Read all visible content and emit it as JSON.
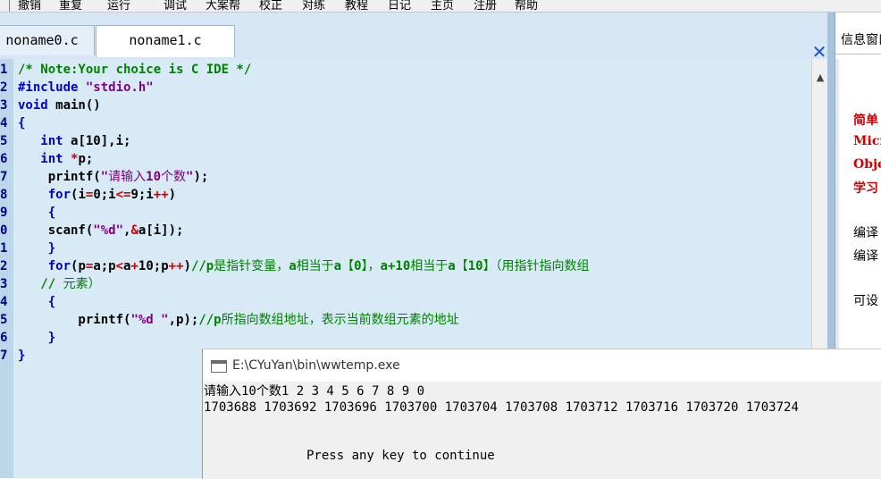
{
  "menu": [
    "撤销",
    "重复",
    "运行",
    "调试",
    "大案帮",
    "校正",
    "对练",
    "教程",
    "日记",
    "主页",
    "注册",
    "帮助"
  ],
  "tabs": [
    {
      "label": "noname0.c",
      "active": false
    },
    {
      "label": "noname1.c",
      "active": true
    }
  ],
  "editor": {
    "line_numbers": [
      "1",
      "2",
      "3",
      "4",
      "5",
      "6",
      "7",
      "8",
      "9",
      "0",
      "1",
      "2",
      "3",
      "4",
      "5",
      "6",
      "7"
    ],
    "lines": [
      [
        {
          "t": "/* Note:Your choice is C IDE */",
          "c": "cm"
        }
      ],
      [
        {
          "t": "#include ",
          "c": "kw"
        },
        {
          "t": "\"stdio.h\"",
          "c": "str"
        }
      ],
      [
        {
          "t": "void",
          "c": "kw"
        },
        {
          "t": " main()",
          "c": ""
        }
      ],
      [
        {
          "t": "{",
          "c": "kw"
        }
      ],
      [
        {
          "t": "   ",
          "c": ""
        },
        {
          "t": "int",
          "c": "kw"
        },
        {
          "t": " a[10],i;",
          "c": ""
        }
      ],
      [
        {
          "t": "   ",
          "c": ""
        },
        {
          "t": "int",
          "c": "kw"
        },
        {
          "t": " ",
          "c": ""
        },
        {
          "t": "*",
          "c": "op"
        },
        {
          "t": "p;",
          "c": ""
        }
      ],
      [
        {
          "t": "    printf(",
          "c": ""
        },
        {
          "t": "\"",
          "c": "str"
        },
        {
          "t": "请输入",
          "c": "str cn"
        },
        {
          "t": "10",
          "c": "str"
        },
        {
          "t": "个数",
          "c": "str cn"
        },
        {
          "t": "\"",
          "c": "str"
        },
        {
          "t": ");",
          "c": ""
        }
      ],
      [
        {
          "t": "    ",
          "c": ""
        },
        {
          "t": "for",
          "c": "kw"
        },
        {
          "t": "(i",
          "c": ""
        },
        {
          "t": "=",
          "c": "op"
        },
        {
          "t": "0;i",
          "c": ""
        },
        {
          "t": "<=",
          "c": "op"
        },
        {
          "t": "9;i",
          "c": ""
        },
        {
          "t": "++",
          "c": "op"
        },
        {
          "t": ")",
          "c": ""
        }
      ],
      [
        {
          "t": "    {",
          "c": "kw"
        }
      ],
      [
        {
          "t": "    scanf(",
          "c": ""
        },
        {
          "t": "\"%d\"",
          "c": "str"
        },
        {
          "t": ",",
          "c": ""
        },
        {
          "t": "&",
          "c": "op"
        },
        {
          "t": "a[i]);",
          "c": ""
        }
      ],
      [
        {
          "t": "    }",
          "c": "kw"
        }
      ],
      [
        {
          "t": "    ",
          "c": ""
        },
        {
          "t": "for",
          "c": "kw"
        },
        {
          "t": "(p",
          "c": ""
        },
        {
          "t": "=",
          "c": "op"
        },
        {
          "t": "a;p",
          "c": ""
        },
        {
          "t": "<",
          "c": "op"
        },
        {
          "t": "a",
          "c": ""
        },
        {
          "t": "+",
          "c": "op"
        },
        {
          "t": "10;p",
          "c": ""
        },
        {
          "t": "++",
          "c": "op"
        },
        {
          "t": ")",
          "c": ""
        },
        {
          "t": "//p",
          "c": "cm"
        },
        {
          "t": "是指针变量，",
          "c": "cm cn"
        },
        {
          "t": "a",
          "c": "cm"
        },
        {
          "t": "相当于",
          "c": "cm cn"
        },
        {
          "t": "a",
          "c": "cm"
        },
        {
          "t": "【",
          "c": "cm cn"
        },
        {
          "t": "0",
          "c": "cm"
        },
        {
          "t": "】，",
          "c": "cm cn"
        },
        {
          "t": "a+10",
          "c": "cm"
        },
        {
          "t": "相当于",
          "c": "cm cn"
        },
        {
          "t": "a",
          "c": "cm"
        },
        {
          "t": "【",
          "c": "cm cn"
        },
        {
          "t": "10",
          "c": "cm"
        },
        {
          "t": "】（用指针指向数组",
          "c": "cm cn"
        }
      ],
      [
        {
          "t": "   // ",
          "c": "cm"
        },
        {
          "t": "元素）",
          "c": "cm cn"
        }
      ],
      [
        {
          "t": "    {",
          "c": "kw"
        }
      ],
      [
        {
          "t": "        printf(",
          "c": ""
        },
        {
          "t": "\"%d \"",
          "c": "str"
        },
        {
          "t": ",p);",
          "c": ""
        },
        {
          "t": "//p",
          "c": "cm"
        },
        {
          "t": "所指向数组地址，表示当前数组元素的地址",
          "c": "cm cn"
        }
      ],
      [
        {
          "t": "    }",
          "c": "kw"
        }
      ],
      [
        {
          "t": "}",
          "c": "kw"
        }
      ]
    ]
  },
  "info_panel": {
    "title": "信息窗口",
    "items": [
      {
        "text": "简单",
        "style": "red"
      },
      {
        "text": "Micro",
        "style": "red"
      },
      {
        "text": "Obje",
        "style": "red"
      },
      {
        "text": "学习",
        "style": "red"
      },
      {
        "text": "编译",
        "style": ""
      },
      {
        "text": "编译",
        "style": ""
      },
      {
        "text": "可设",
        "style": ""
      }
    ]
  },
  "console": {
    "title": "E:\\CYuYan\\bin\\wwtemp.exe",
    "prompt_line": "请输入10个数1 2 3 4 5 6 7 8 9 0",
    "output_line": "1703688 1703692 1703696 1703700 1703704 1703708 1703712 1703716 1703720 1703724",
    "continue_line": "Press any key to continue"
  },
  "colors": {
    "keyword": "#0000cc",
    "comment": "#008000",
    "string": "#800080",
    "operator": "#d00000"
  }
}
